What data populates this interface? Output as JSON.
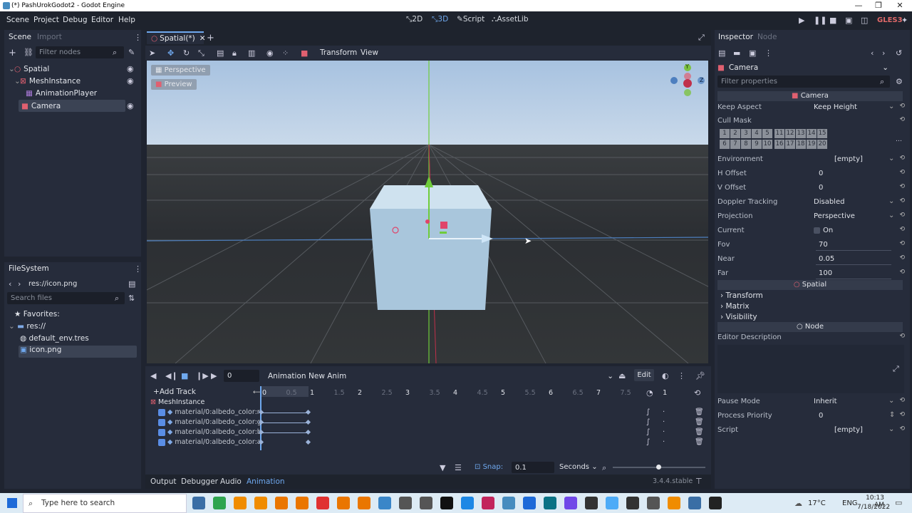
{
  "window": {
    "title": "(*) PashUrokGodot2 - Godot Engine"
  },
  "menu": [
    "Scene",
    "Project",
    "Debug",
    "Editor",
    "Help"
  ],
  "modes": {
    "m2d": "2D",
    "m3d": "3D",
    "script": "Script",
    "assetlib": "AssetLib"
  },
  "renderer": "GLES3",
  "scene_dock": {
    "tab_scene": "Scene",
    "tab_import": "Import",
    "filter_placeholder": "Filter nodes",
    "nodes": [
      {
        "label": "Spatial"
      },
      {
        "label": "MeshInstance"
      },
      {
        "label": "AnimationPlayer"
      },
      {
        "label": "Camera"
      }
    ]
  },
  "filesystem": {
    "title": "FileSystem",
    "path": "res://icon.png",
    "search_placeholder": "Search files",
    "items": [
      "Favorites:",
      "res://",
      "default_env.tres",
      "icon.png"
    ]
  },
  "editor_tab": {
    "label": "Spatial(*)"
  },
  "viewport": {
    "menu_transform": "Transform",
    "menu_view": "View",
    "perspective": "Perspective",
    "preview": "Preview",
    "gizmo_y": "Y",
    "gizmo_z": "Z"
  },
  "inspector": {
    "tab_inspector": "Inspector",
    "tab_node": "Node",
    "object": "Camera",
    "filter_placeholder": "Filter properties",
    "section_camera": "Camera",
    "keep_aspect_label": "Keep Aspect",
    "keep_aspect": "Keep Height",
    "cull_mask_label": "Cull Mask",
    "cull_row1": [
      "1",
      "2",
      "3",
      "4",
      "5",
      "11",
      "12",
      "13",
      "14",
      "15"
    ],
    "cull_row2": [
      "6",
      "7",
      "8",
      "9",
      "10",
      "16",
      "17",
      "18",
      "19",
      "20"
    ],
    "environment_label": "Environment",
    "environment": "[empty]",
    "h_offset_label": "H Offset",
    "h_offset": "0",
    "v_offset_label": "V Offset",
    "v_offset": "0",
    "doppler_label": "Doppler Tracking",
    "doppler": "Disabled",
    "projection_label": "Projection",
    "projection": "Perspective",
    "current_label": "Current",
    "current": "On",
    "fov_label": "Fov",
    "fov": "70",
    "near_label": "Near",
    "near": "0.05",
    "far_label": "Far",
    "far": "100",
    "section_spatial": "Spatial",
    "groups": [
      "Transform",
      "Matrix",
      "Visibility"
    ],
    "section_node": "Node",
    "editor_desc_label": "Editor Description",
    "pause_mode_label": "Pause Mode",
    "pause_mode": "Inherit",
    "priority_label": "Process Priority",
    "priority": "0",
    "script_label": "Script",
    "script": "[empty]"
  },
  "animation": {
    "time": "0",
    "anim_button": "Animation",
    "anim_name": "New Anim",
    "edit": "Edit",
    "add_track": "Add Track",
    "ticks": [
      "0",
      "0.5",
      "1",
      "1.5",
      "2",
      "2.5",
      "3",
      "3.5",
      "4",
      "4.5",
      "5",
      "5.5",
      "6",
      "6.5",
      "7",
      "7.5"
    ],
    "length": "1",
    "node": "MeshInstance",
    "tracks": [
      "material/0:albedo_color:r",
      "material/0:albedo_color:g",
      "material/0:albedo_color:b",
      "material/0:albedo_color:a"
    ],
    "snap_label": "Snap:",
    "snap": "0.1",
    "unit": "Seconds"
  },
  "bottom_tabs": [
    "Output",
    "Debugger",
    "Audio",
    "Animation"
  ],
  "version": "3.4.4.stable",
  "taskbar": {
    "search": "Type here to search",
    "weather": "17°C",
    "lang": "ENG",
    "time": "10:13 AM",
    "date": "7/18/2022"
  }
}
